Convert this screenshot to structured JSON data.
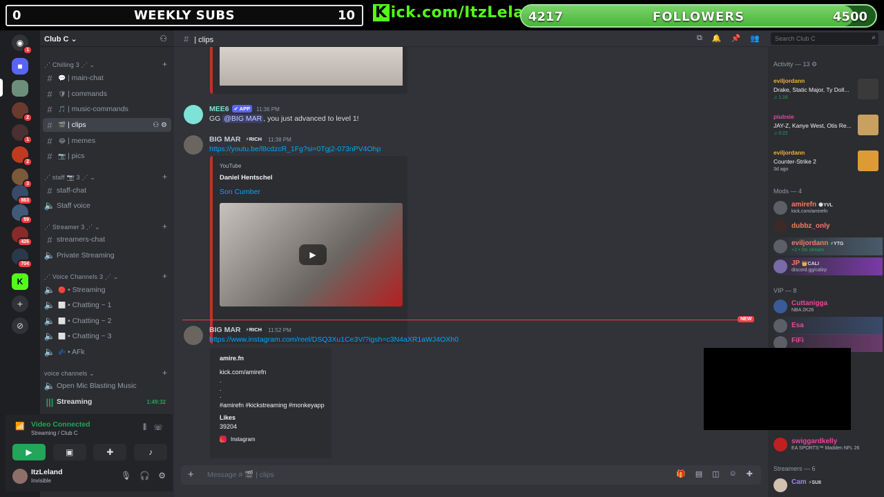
{
  "overlay": {
    "subs_min": "0",
    "subs_label": "WEEKLY SUBS",
    "subs_max": "10",
    "kick_url": "ick.com/ItzLeland",
    "kick_k": "K",
    "followers_current": "4217",
    "followers_label": "FOLLOWERS",
    "followers_goal": "4500",
    "followers_progress": 0.937
  },
  "rail": {
    "badges": [
      "1",
      "2",
      "1",
      "2",
      "3",
      "863",
      "59",
      "426",
      "704"
    ]
  },
  "guild": {
    "name": "Club C ⌄"
  },
  "categories": [
    {
      "label": "⋰ Chilling 3 ⋰ ⌄"
    },
    {
      "label": "⋰ staff 📷 3 ⋰ ⌄"
    },
    {
      "label": "⋰ Streamer 3 ⋰ ⌄"
    },
    {
      "label": "⋰ Voice Channels 3 ⋰ ⌄"
    },
    {
      "label": "voice channels ⌄"
    }
  ],
  "channels": [
    {
      "name": "| main-chat",
      "icon": "💬"
    },
    {
      "name": "| commands",
      "icon": "🛡"
    },
    {
      "name": "| music-commands",
      "icon": "🎵"
    },
    {
      "name": "| clips",
      "icon": "🎬"
    },
    {
      "name": "| memes",
      "icon": "😂"
    },
    {
      "name": "| pics",
      "icon": "📷"
    },
    {
      "name": "staff-chat"
    },
    {
      "name": "Staff voice"
    },
    {
      "name": "streamers-chat"
    },
    {
      "name": "Private Streaming"
    },
    {
      "name": "• Streaming",
      "icon": "🔴"
    },
    {
      "name": "• Chatting ~ 1",
      "icon": "⬜"
    },
    {
      "name": "• Chatting ~ 2",
      "icon": "⬜"
    },
    {
      "name": "• Chatting ~ 3",
      "icon": "⬜"
    },
    {
      "name": "• AFk",
      "icon": "💤"
    },
    {
      "name": "Open Mic Blasting Music"
    },
    {
      "name": "Streaming",
      "timer": "1:49:32"
    }
  ],
  "voice": {
    "status": "Video Connected",
    "sub": "Streaming / Club C"
  },
  "me": {
    "name": "ItzLeland",
    "status": "Invisible"
  },
  "topbar": {
    "channel": "| clips",
    "search_placeholder": "Search Club C"
  },
  "messages": {
    "mee6": {
      "author": "MEE6",
      "tag": "✔ APP",
      "time": "11:36 PM",
      "pre": "GG ",
      "mention": "@BIG MAR",
      "post": ", you just advanced to level 1!"
    },
    "bigmar1": {
      "author": "BIG MAR",
      "tag": "⚡RICH",
      "time": "11:38 PM",
      "link": "https://youtu.be/l8cdzcR_1Fg?si=0Tgj2-073nPV4Ohp",
      "provider": "YouTube",
      "embed_author": "Daniel Hentschel",
      "embed_title": "Son Cumber"
    },
    "new_label": "NEW",
    "bigmar2": {
      "author": "BIG MAR",
      "tag": "⚡RICH",
      "time": "11:52 PM",
      "link": "https://www.instagram.com/reel/DSQ3Xu1Ce3V/?igsh=c3N4aXR1aWJ4OXh0",
      "ig_user": "amire.fn",
      "ig_line1": "kick.com/amirefn",
      "ig_dot1": ".",
      "ig_dot2": ".",
      "ig_dot3": ".",
      "ig_tags": "#amirefn #kickstreaming #monkeyapp",
      "ig_likes_label": "Likes",
      "ig_likes": "39204",
      "ig_source": "Instagram"
    }
  },
  "composer": {
    "placeholder": "Message # 🎬 | clips"
  },
  "members": {
    "activity_head": "Activity — 13 ⚙",
    "activities": [
      {
        "who": "eviljordann",
        "what": "Drake, Static Major, Ty Doll...",
        "when": "♫ 1:16"
      },
      {
        "who": "piubsie",
        "what": "JAY-Z, Kanye West, Otis Re...",
        "when": "♫ 0:22"
      },
      {
        "who": "eviljordann",
        "what": "Counter-Strike 2",
        "when": "3d ago"
      }
    ],
    "mods_head": "Mods — 4",
    "mods": [
      {
        "name": "amirefn",
        "tag": "🌑YVL",
        "stat": "kick.com/amirefn",
        "color": "#f47b67"
      },
      {
        "name": "dubbz_only",
        "tag": "",
        "stat": "",
        "color": "#f47b67"
      },
      {
        "name": "eviljordann",
        "tag": "⚡YTG",
        "stat": "+2 • On stream",
        "color": "#f47b67"
      },
      {
        "name": "JP",
        "tag": "👑CALI",
        "stat": "discord.gg/calirp",
        "color": "#f47b67"
      }
    ],
    "vip_head": "VIP — 8",
    "vips": [
      {
        "name": "Cuttanigga",
        "stat": "NBA 2K26",
        "color": "#eb459e"
      },
      {
        "name": "Esa",
        "stat": "",
        "color": "#eb459e"
      },
      {
        "name": "FiFi",
        "stat": "",
        "color": "#eb459e"
      },
      {
        "name": "swiggardkelly",
        "stat": "EA SPORTS™ Madden NFL 26",
        "color": "#eb459e"
      }
    ],
    "streamers_head": "Streamers — 6",
    "streamers": [
      {
        "name": "Cam",
        "tag": "⚡SUII",
        "color": "#9b84ee"
      }
    ]
  }
}
